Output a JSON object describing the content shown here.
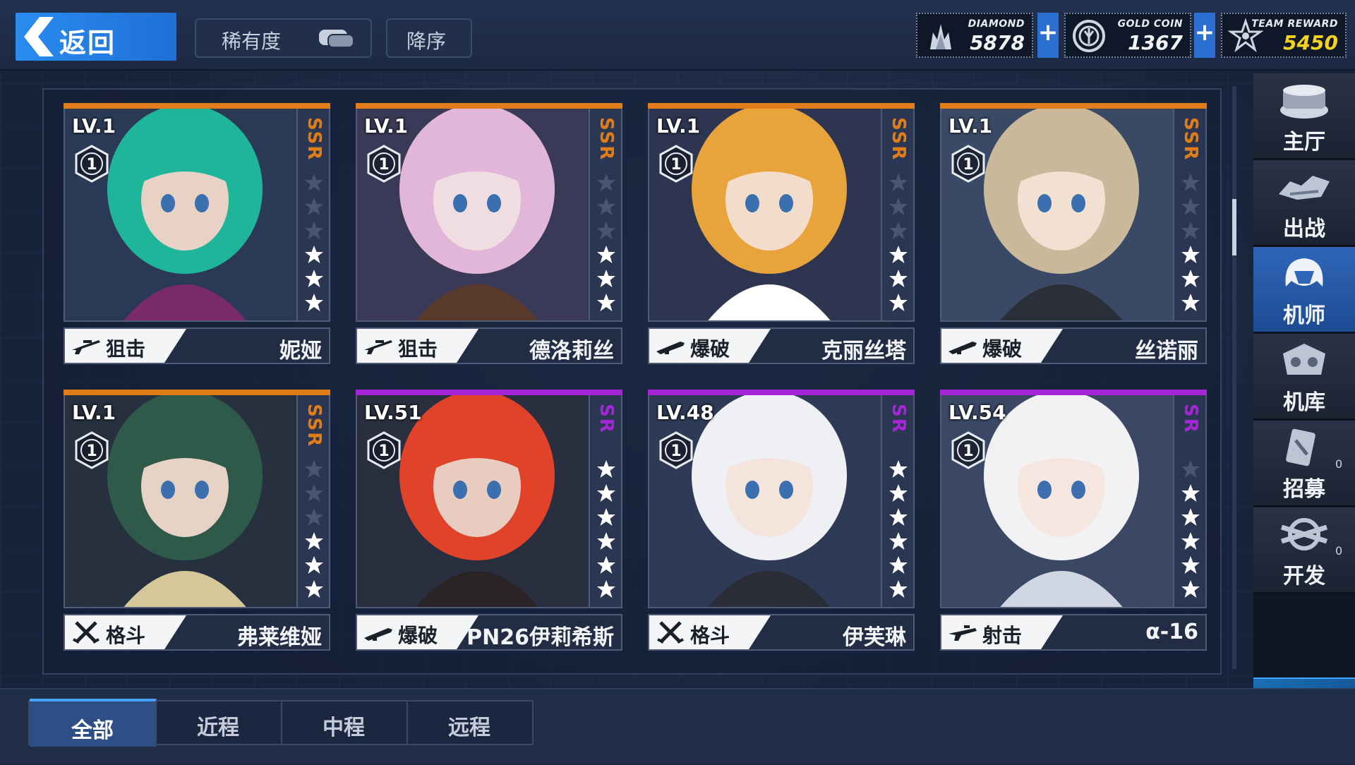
{
  "header": {
    "back_label": "返回",
    "sort_rarity_label": "稀有度",
    "sort_order_label": "降序",
    "currencies": [
      {
        "name": "DIAMOND",
        "value": "5878",
        "icon": "diamond-icon",
        "value_color": "#f2f4f8"
      },
      {
        "name": "GOLD COIN",
        "value": "1367",
        "icon": "gold-coin-icon",
        "value_color": "#f2f4f8"
      },
      {
        "name": "TEAM REWARD",
        "value": "5450",
        "icon": "team-reward-icon",
        "value_color": "#f5d21e"
      }
    ],
    "plus_label": "+"
  },
  "colors": {
    "ssr": "#e07d18",
    "sr": "#a526d6",
    "active_nav": "#2f66b8"
  },
  "cards": [
    {
      "level": "LV.1",
      "rank": "1",
      "rarity": "SSR",
      "stars": 3,
      "max_stars": 6,
      "type": "狙击",
      "type_icon": "sniper-rifle-icon",
      "name": "妮娅"
    },
    {
      "level": "LV.1",
      "rank": "1",
      "rarity": "SSR",
      "stars": 3,
      "max_stars": 6,
      "type": "狙击",
      "type_icon": "sniper-rifle-icon",
      "name": "德洛莉丝"
    },
    {
      "level": "LV.1",
      "rank": "1",
      "rarity": "SSR",
      "stars": 3,
      "max_stars": 6,
      "type": "爆破",
      "type_icon": "launcher-icon",
      "name": "克丽丝塔"
    },
    {
      "level": "LV.1",
      "rank": "1",
      "rarity": "SSR",
      "stars": 3,
      "max_stars": 6,
      "type": "爆破",
      "type_icon": "launcher-icon",
      "name": "丝诺丽"
    },
    {
      "level": "LV.1",
      "rank": "1",
      "rarity": "SSR",
      "stars": 3,
      "max_stars": 6,
      "type": "格斗",
      "type_icon": "crossed-swords-icon",
      "name": "弗莱维娅"
    },
    {
      "level": "LV.51",
      "rank": "1",
      "rarity": "SR",
      "stars": 6,
      "max_stars": 6,
      "type": "爆破",
      "type_icon": "launcher-icon",
      "name": "PN26伊莉希斯"
    },
    {
      "level": "LV.48",
      "rank": "1",
      "rarity": "SR",
      "stars": 6,
      "max_stars": 6,
      "type": "格斗",
      "type_icon": "crossed-swords-icon",
      "name": "伊芙琳"
    },
    {
      "level": "LV.54",
      "rank": "1",
      "rarity": "SR",
      "stars": 5,
      "max_stars": 6,
      "type": "射击",
      "type_icon": "rifle-icon",
      "name": "α-16"
    }
  ],
  "nav": [
    {
      "label": "主厅",
      "icon": "hall-icon",
      "active": false
    },
    {
      "label": "出战",
      "icon": "sortie-icon",
      "active": false
    },
    {
      "label": "机师",
      "icon": "pilot-icon",
      "active": true
    },
    {
      "label": "机库",
      "icon": "hangar-icon",
      "active": false
    },
    {
      "label": "招募",
      "icon": "recruit-icon",
      "active": false,
      "count": "0"
    },
    {
      "label": "开发",
      "icon": "develop-icon",
      "active": false,
      "count": "0"
    }
  ],
  "tabs": [
    {
      "label": "全部",
      "active": true
    },
    {
      "label": "近程",
      "active": false
    },
    {
      "label": "中程",
      "active": false
    },
    {
      "label": "远程",
      "active": false
    }
  ]
}
